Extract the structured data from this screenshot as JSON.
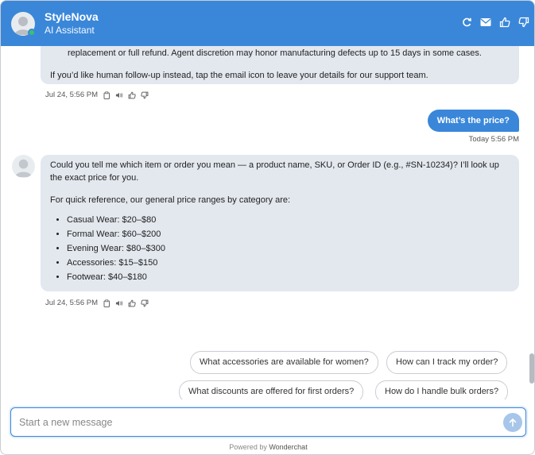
{
  "header": {
    "brand_name": "StyleNova",
    "brand_sub": "AI Assistant",
    "icons": [
      "refresh-icon",
      "email-icon",
      "thumbs-up-icon",
      "thumbs-down-icon"
    ],
    "accent": "#3a87d9"
  },
  "messages": {
    "prev_bot": {
      "line1": "replacement or full refund. Agent discretion may honor manufacturing defects up to 15 days in some cases.",
      "line2": "If you’d like human follow-up instead, tap the email icon to leave your details for our support team.",
      "time": "Jul 24, 5:56 PM"
    },
    "user": {
      "text": "What’s the price?",
      "time": "Today 5:56 PM"
    },
    "bot": {
      "para1": "Could you tell me which item or order you mean — a product name, SKU, or Order ID (e.g., #SN-10234)? I’ll look up the exact price for you.",
      "para2": "For quick reference, our general price ranges by category are:",
      "prices": [
        "Casual Wear: $20–$80",
        "Formal Wear: $60–$200",
        "Evening Wear: $80–$300",
        "Accessories: $15–$150",
        "Footwear: $40–$180"
      ],
      "time": "Jul 24, 5:56 PM"
    }
  },
  "suggestions": [
    "What accessories are available for women?",
    "How can I track my order?",
    "What discounts are offered for first orders?",
    "How do I handle bulk orders?"
  ],
  "composer": {
    "placeholder": "Start a new message"
  },
  "footer": {
    "prefix": "Powered by ",
    "brand": "Wonderchat"
  }
}
